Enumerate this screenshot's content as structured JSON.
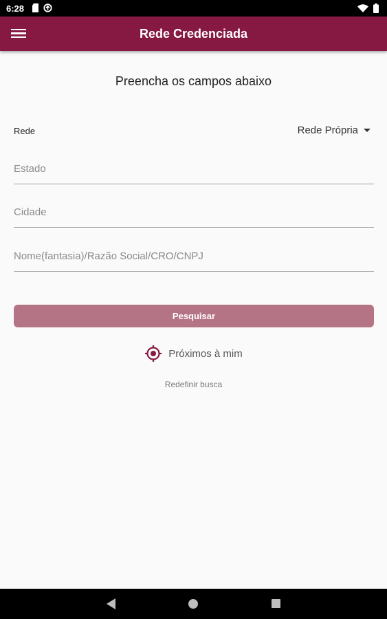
{
  "status_bar": {
    "time": "6:28",
    "icons_left": [
      "sd-card-icon",
      "sync-icon"
    ],
    "icons_right": [
      "wifi-icon",
      "battery-icon"
    ]
  },
  "app_bar": {
    "title": "Rede Credenciada",
    "background": "#861942",
    "menu_icon": "menu-icon"
  },
  "form": {
    "heading": "Preencha os campos abaixo",
    "rede_label": "Rede",
    "rede_value": "Rede Própria",
    "estado_placeholder": "Estado",
    "cidade_placeholder": "Cidade",
    "nome_placeholder": "Nome(fantasia)/Razão Social/CRO/CNPJ",
    "search_button": "Pesquisar",
    "nearby_label": "Próximos à mim",
    "reset_label": "Redefinir busca"
  },
  "colors": {
    "primary": "#861942",
    "button": "#b57486"
  }
}
